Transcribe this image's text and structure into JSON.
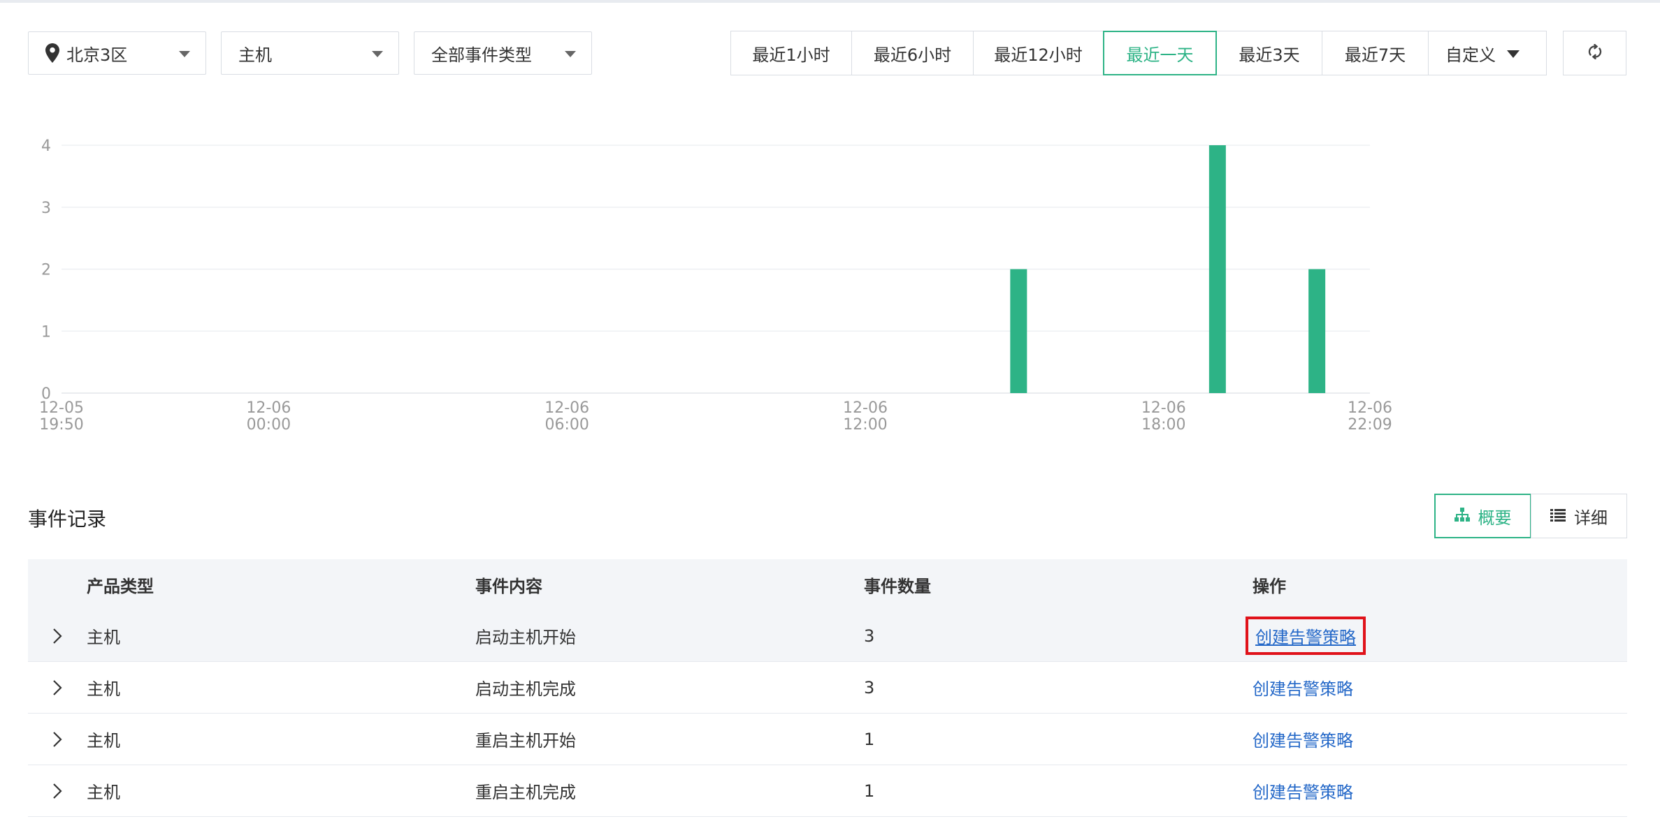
{
  "filters": {
    "region": "北京3区",
    "product": "主机",
    "event_type": "全部事件类型"
  },
  "time_range": {
    "options": [
      "最近1小时",
      "最近6小时",
      "最近12小时",
      "最近一天",
      "最近3天",
      "最近7天"
    ],
    "selected": "最近一天",
    "custom_label": "自定义"
  },
  "icons": {
    "location": "map-pin-icon",
    "dropdown": "caret-down-icon",
    "refresh": "refresh-icon",
    "overview": "sitemap-icon",
    "detail": "list-icon",
    "expand": "chevron-right-icon"
  },
  "colors": {
    "accent": "#2db386",
    "link": "#2468c8",
    "highlight": "#e0121a"
  },
  "chart_data": {
    "type": "bar",
    "ylim": [
      0,
      4
    ],
    "yticks": [
      0,
      1,
      2,
      3,
      4
    ],
    "xticks": [
      {
        "date": "12-05",
        "time": "19:50"
      },
      {
        "date": "12-06",
        "time": "00:00"
      },
      {
        "date": "12-06",
        "time": "06:00"
      },
      {
        "date": "12-06",
        "time": "12:00"
      },
      {
        "date": "12-06",
        "time": "18:00"
      },
      {
        "date": "12-06",
        "time": "22:09"
      }
    ],
    "x_start": "12-05 19:50",
    "x_end": "12-06 22:09",
    "bars": [
      {
        "time": "12-06 15:05",
        "value": 2
      },
      {
        "time": "12-06 19:05",
        "value": 4
      },
      {
        "time": "12-06 21:05",
        "value": 2
      }
    ],
    "color": "#2db386",
    "grid": true
  },
  "section": {
    "title": "事件记录",
    "view_overview": "概要",
    "view_detail": "详细"
  },
  "table": {
    "headers": {
      "product_type": "产品类型",
      "content": "事件内容",
      "count": "事件数量",
      "operation": "操作"
    },
    "rows": [
      {
        "product_type": "主机",
        "content": "启动主机开始",
        "count": "3",
        "operation": "创建告警策略"
      },
      {
        "product_type": "主机",
        "content": "启动主机完成",
        "count": "3",
        "operation": "创建告警策略"
      },
      {
        "product_type": "主机",
        "content": "重启主机开始",
        "count": "1",
        "operation": "创建告警策略"
      },
      {
        "product_type": "主机",
        "content": "重启主机完成",
        "count": "1",
        "operation": "创建告警策略"
      }
    ]
  }
}
